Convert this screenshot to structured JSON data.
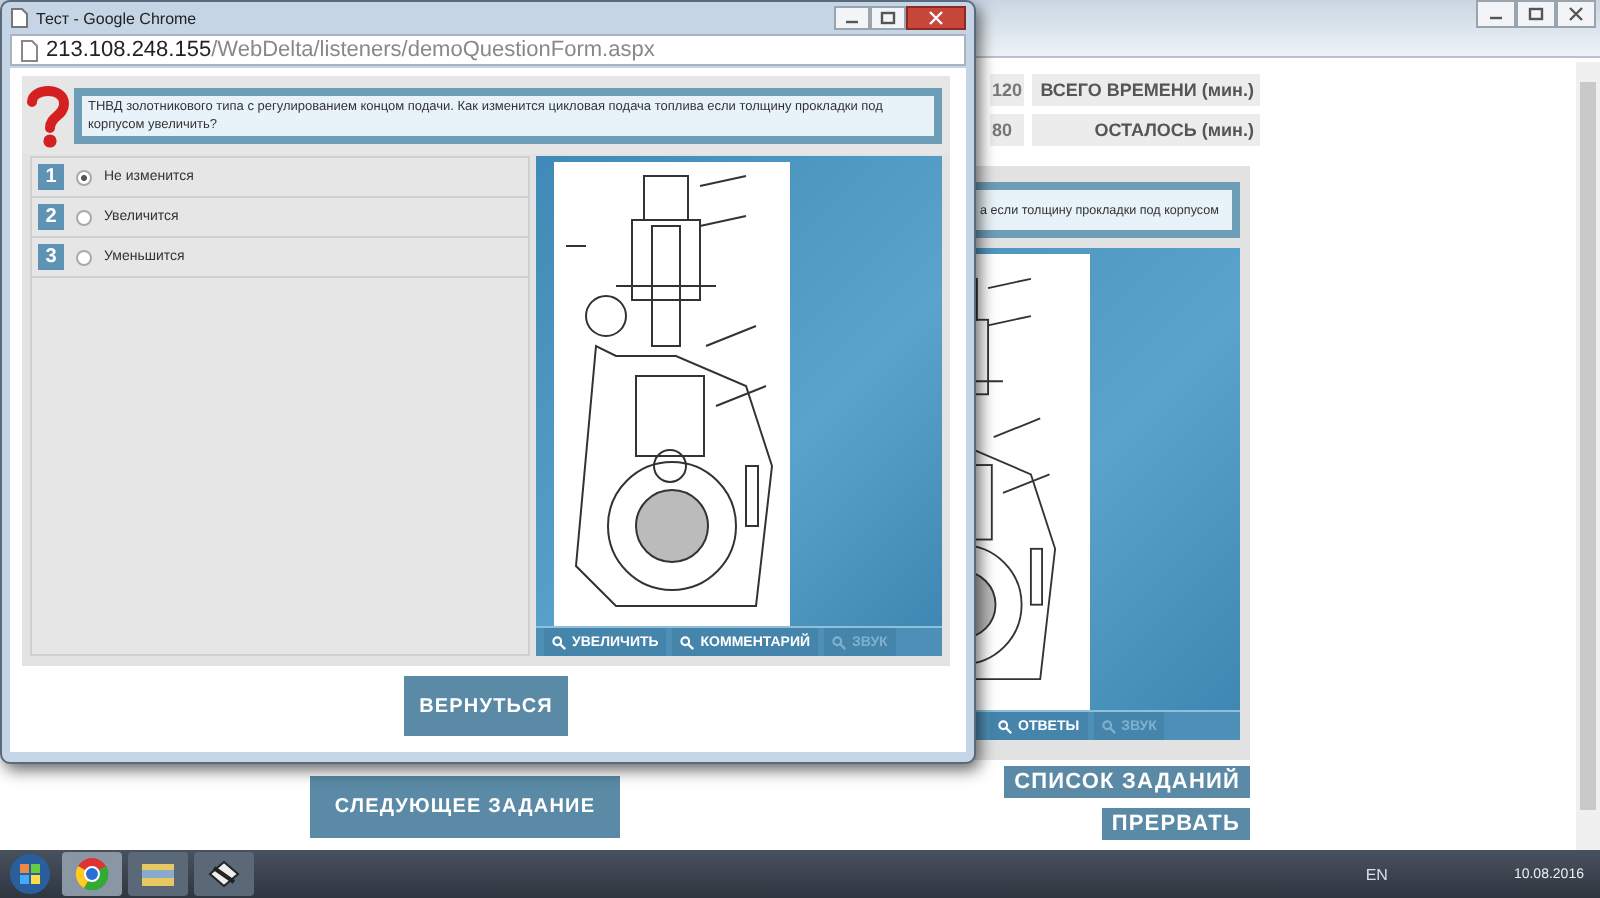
{
  "background_page": {
    "stats": [
      {
        "value": "120",
        "label": "ВСЕГО ВРЕМЕНИ (мин.)"
      },
      {
        "value": "80",
        "label": "ОСТАЛОСЬ (мин.)"
      }
    ],
    "question_text": "а если толщину прокладки под корпусом",
    "image_tools": [
      {
        "label": "ОТВЕТЫ",
        "disabled": false
      },
      {
        "label": "ЗВУК",
        "disabled": true
      }
    ],
    "side_buttons": [
      "СПИСОК ЗАДАНИЙ",
      "ПРЕРВАТЬ"
    ],
    "next_button": "СЛЕДУЮЩЕЕ ЗАДАНИЕ"
  },
  "popup": {
    "title": "Тест - Google Chrome",
    "url_host": "213.108.248.155",
    "url_path": "/WebDelta/listeners/demoQuestionForm.aspx",
    "question": "ТНВД золотникового типа с регулированием концом подачи. Как изменится цикловая подача топлива если толщину прокладки под корпусом увеличить?",
    "answers": [
      {
        "number": "1",
        "label": "Не изменится",
        "selected": true
      },
      {
        "number": "2",
        "label": "Увеличится",
        "selected": false
      },
      {
        "number": "3",
        "label": "Уменьшится",
        "selected": false
      }
    ],
    "image_tools": [
      {
        "label": "УВЕЛИЧИТЬ",
        "disabled": false
      },
      {
        "label": "КОММЕНТАРИЙ",
        "disabled": false
      },
      {
        "label": "ЗВУК",
        "disabled": true
      }
    ],
    "back_button": "ВЕРНУТЬСЯ"
  },
  "taskbar": {
    "language": "EN",
    "date": "10.08.2016"
  }
}
